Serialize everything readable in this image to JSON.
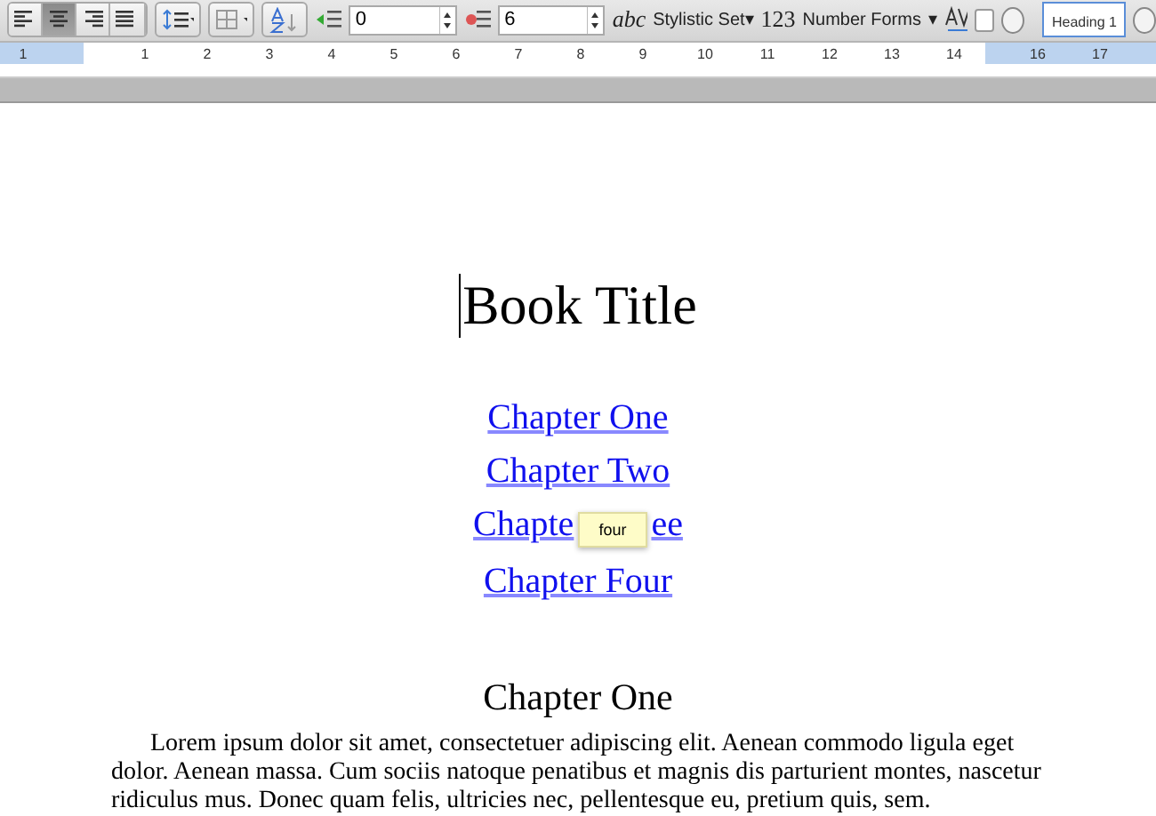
{
  "toolbar": {
    "align_buttons": [
      {
        "kind": "left",
        "selected": false
      },
      {
        "kind": "center",
        "selected": true
      },
      {
        "kind": "right",
        "selected": false
      },
      {
        "kind": "justify",
        "selected": false
      }
    ],
    "left_indent": "0",
    "right_indent": "6",
    "stylistic_set": {
      "sample": "abc",
      "label": "Stylistic Set▾"
    },
    "number_forms": {
      "sample": "123",
      "label": "Number Forms",
      "caret": "▾"
    },
    "kerning_checked": false,
    "style_gallery": {
      "label": "Heading 1"
    }
  },
  "ruler": {
    "marks": [
      "1",
      "1",
      "2",
      "3",
      "4",
      "5",
      "6",
      "7",
      "8",
      "9",
      "10",
      "11",
      "12",
      "13",
      "14",
      "16",
      "17"
    ]
  },
  "document": {
    "title": "Book Title",
    "toc": [
      {
        "text": "Chapter One"
      },
      {
        "text": "Chapter Two"
      },
      {
        "text": "Chapte",
        "text_after": "ee"
      },
      {
        "text": "Chapter Four"
      }
    ],
    "tooltip": "four",
    "heading": "Chapter One",
    "paragraph": "Lorem ipsum dolor sit amet, consectetuer adipiscing elit. Aenean commodo ligula eget dolor. Aenean massa. Cum sociis natoque penatibus et magnis dis parturient montes, nascetur ridiculus mus. Donec quam felis, ultricies nec, pellentesque eu, pretium quis, sem."
  }
}
